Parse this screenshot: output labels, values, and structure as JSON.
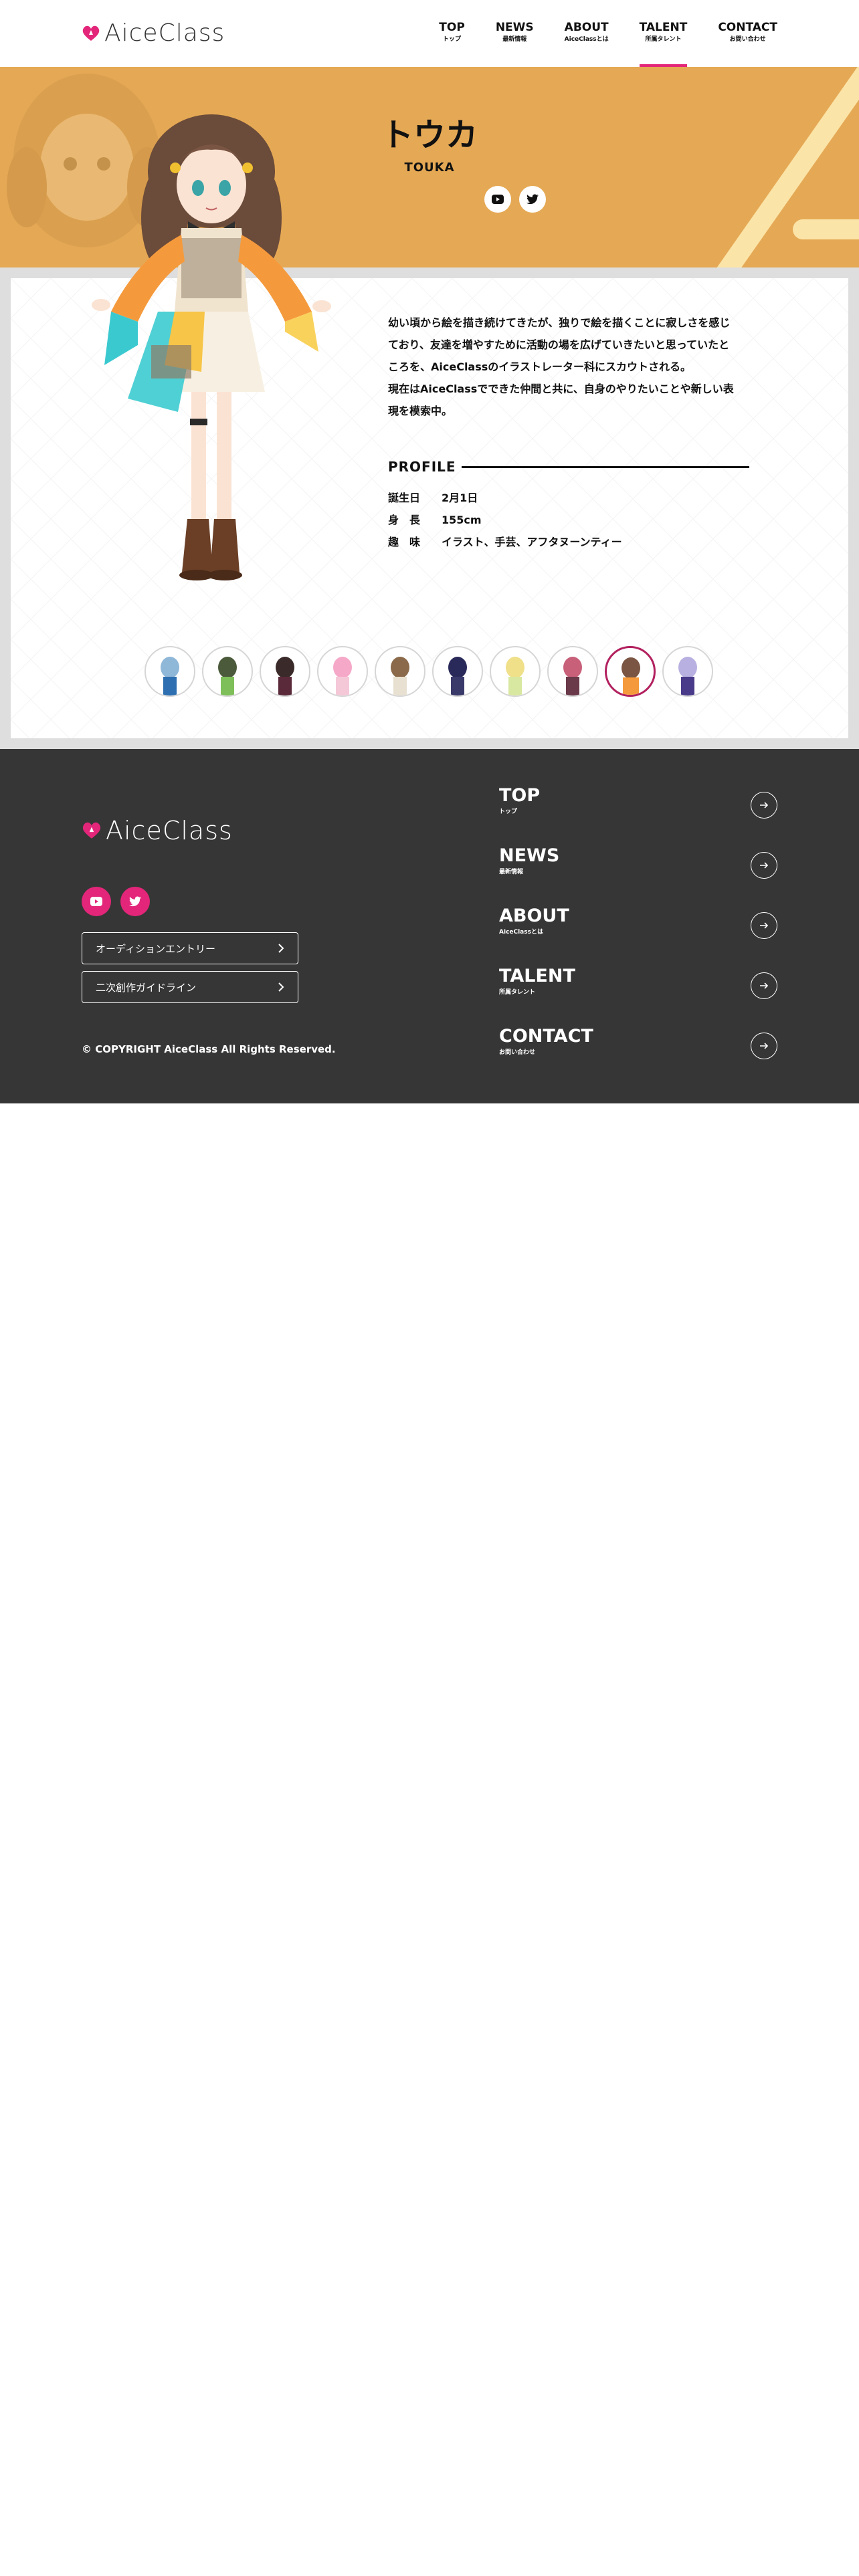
{
  "brand": {
    "logo_text": "AiceClass",
    "accent_color": "#e3267a"
  },
  "nav": {
    "items": [
      {
        "label": "TOP",
        "sub": "トップ",
        "active": false
      },
      {
        "label": "NEWS",
        "sub": "最新情報",
        "active": false
      },
      {
        "label": "ABOUT",
        "sub": "AiceClassとは",
        "active": false
      },
      {
        "label": "TALENT",
        "sub": "所属タレント",
        "active": true
      },
      {
        "label": "CONTACT",
        "sub": "お問い合わせ",
        "active": false
      }
    ]
  },
  "hero": {
    "name": "トウカ",
    "name_en": "TOUKA",
    "background_color": "#e5a955",
    "social": [
      {
        "icon": "youtube-icon"
      },
      {
        "icon": "twitter-icon"
      }
    ]
  },
  "talent": {
    "description_lines": [
      "幼い頃から絵を描き続けてきたが、独りで絵を描くことに寂しさを感じ",
      "ており、友達を増やすために活動の場を広げていきたいと思っていたと",
      "ころを、AiceClassのイラストレーター科にスカウトされる。",
      "現在はAiceClassでできた仲間と共に、自身のやりたいことや新しい表",
      "現を模索中。"
    ],
    "profile_heading": "PROFILE",
    "profile": [
      {
        "key": "誕生日",
        "value": "2月1日"
      },
      {
        "key": "身　長",
        "value": "155cm"
      },
      {
        "key": "趣　味",
        "value": "イラスト、手芸、アフタヌーンティー"
      }
    ],
    "thumbnails_count": 10,
    "thumbnail_active_index": 8
  },
  "footer": {
    "logo_text": "AiceClass",
    "buttons": [
      "オーディションエントリー",
      "二次創作ガイドライン"
    ],
    "copyright": "© COPYRIGHT AiceClass All Rights Reserved.",
    "nav": [
      {
        "label": "TOP",
        "sub": "トップ"
      },
      {
        "label": "NEWS",
        "sub": "最新情報"
      },
      {
        "label": "ABOUT",
        "sub": "AiceClassとは"
      },
      {
        "label": "TALENT",
        "sub": "所属タレント"
      },
      {
        "label": "CONTACT",
        "sub": "お問い合わせ"
      }
    ]
  }
}
